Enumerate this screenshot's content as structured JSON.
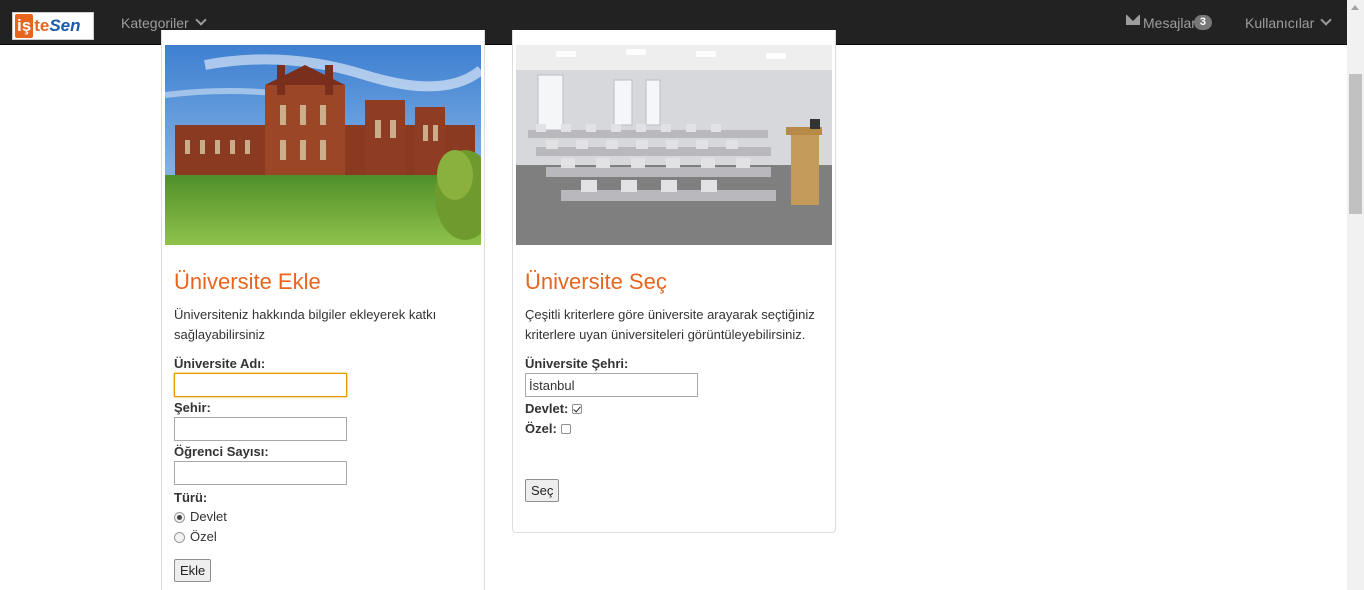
{
  "navbar": {
    "logo": {
      "part1": "iş",
      "part2": "te",
      "part3": "Sen"
    },
    "categories_label": "Kategoriler",
    "messages_label": "Mesajlar",
    "messages_count": "3",
    "users_label": "Kullanıcılar"
  },
  "add_panel": {
    "title": "Üniversite Ekle",
    "description": "Üniversiteniz hakkında bilgiler ekleyerek katkı sağlayabilirsiniz",
    "name_label": "Üniversite Adı:",
    "name_value": "",
    "city_label": "Şehir:",
    "city_value": "",
    "students_label": "Öğrenci Sayısı:",
    "students_value": "",
    "type_label": "Türü:",
    "type_options": [
      "Devlet",
      "Özel"
    ],
    "type_selected": "Devlet",
    "submit_label": "Ekle"
  },
  "select_panel": {
    "title": "Üniversite Seç",
    "description": "Çeşitli kriterlere göre üniversite arayarak seçtiğiniz kriterlere uyan üniversiteleri görüntüleyebilirsiniz.",
    "city_label": "Üniversite Şehri:",
    "city_value": "İstanbul",
    "state_label": "Devlet:",
    "state_checked": true,
    "private_label": "Özel:",
    "private_checked": false,
    "submit_label": "Seç"
  },
  "colors": {
    "accent": "#e8651e",
    "navbar": "#222222"
  }
}
